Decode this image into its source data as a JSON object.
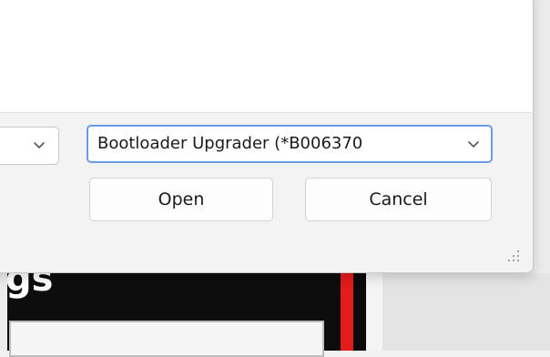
{
  "background": {
    "heading_fragment": "gs"
  },
  "dialog": {
    "left_combo": {
      "value": ""
    },
    "file_type_combo": {
      "value": "Bootloader Upgrader (*B006370"
    },
    "buttons": {
      "open_label": "Open",
      "cancel_label": "Cancel"
    }
  },
  "colors": {
    "focus_border": "#6a9be8",
    "accent_red": "#e31b1b"
  },
  "icons": {
    "combo_chevron": "chevron-down-icon",
    "resize": "resize-grip-icon"
  }
}
